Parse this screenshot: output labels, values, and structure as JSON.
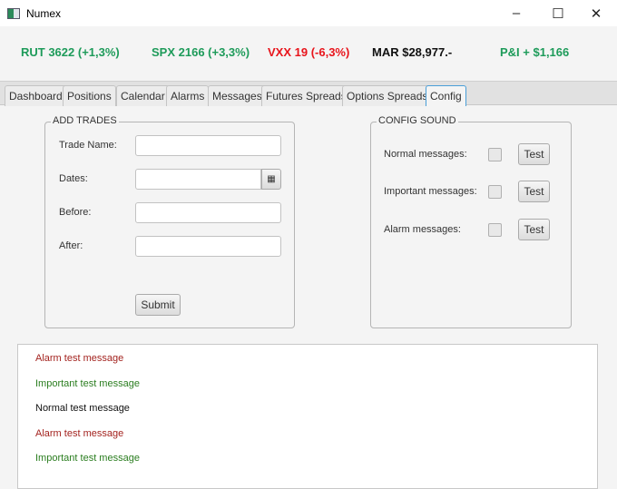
{
  "window": {
    "title": "Numex",
    "minimize": "–",
    "maximize": "☐",
    "close": "✕"
  },
  "tickers": [
    {
      "text": "RUT 3622 (+1,3%)",
      "color": "#1e9b5a"
    },
    {
      "text": "SPX 2166 (+3,3%)",
      "color": "#1e9b5a"
    },
    {
      "text": "VXX 19 (-6,3%)",
      "color": "#e8141b"
    },
    {
      "text": "MAR $28,977.-",
      "color": "#111111"
    },
    {
      "text": "P&I + $1,166",
      "color": "#1e9b5a"
    }
  ],
  "tabs": [
    "Dashboard",
    "Positions",
    "Calendar",
    "Alarms",
    "Messages",
    "Futures Spreads",
    "Options Spreads",
    "Config"
  ],
  "add_trades": {
    "legend": "ADD TRADES",
    "trade_name": "Trade Name:",
    "dates": "Dates:",
    "before": "Before:",
    "after": "After:",
    "submit": "Submit",
    "calendar_icon": "calendar-icon"
  },
  "config_sound": {
    "legend": "CONFIG SOUND",
    "normal": "Normal messages:",
    "important": "Important messages:",
    "alarm": "Alarm messages:",
    "test": "Test"
  },
  "messages": [
    {
      "text": "Alarm test message",
      "color": "#a3231f"
    },
    {
      "text": "Important test message",
      "color": "#2a7d1f"
    },
    {
      "text": "Normal test message",
      "color": "#111111"
    },
    {
      "text": "Alarm test message",
      "color": "#a3231f"
    },
    {
      "text": "Important test message",
      "color": "#2a7d1f"
    }
  ]
}
